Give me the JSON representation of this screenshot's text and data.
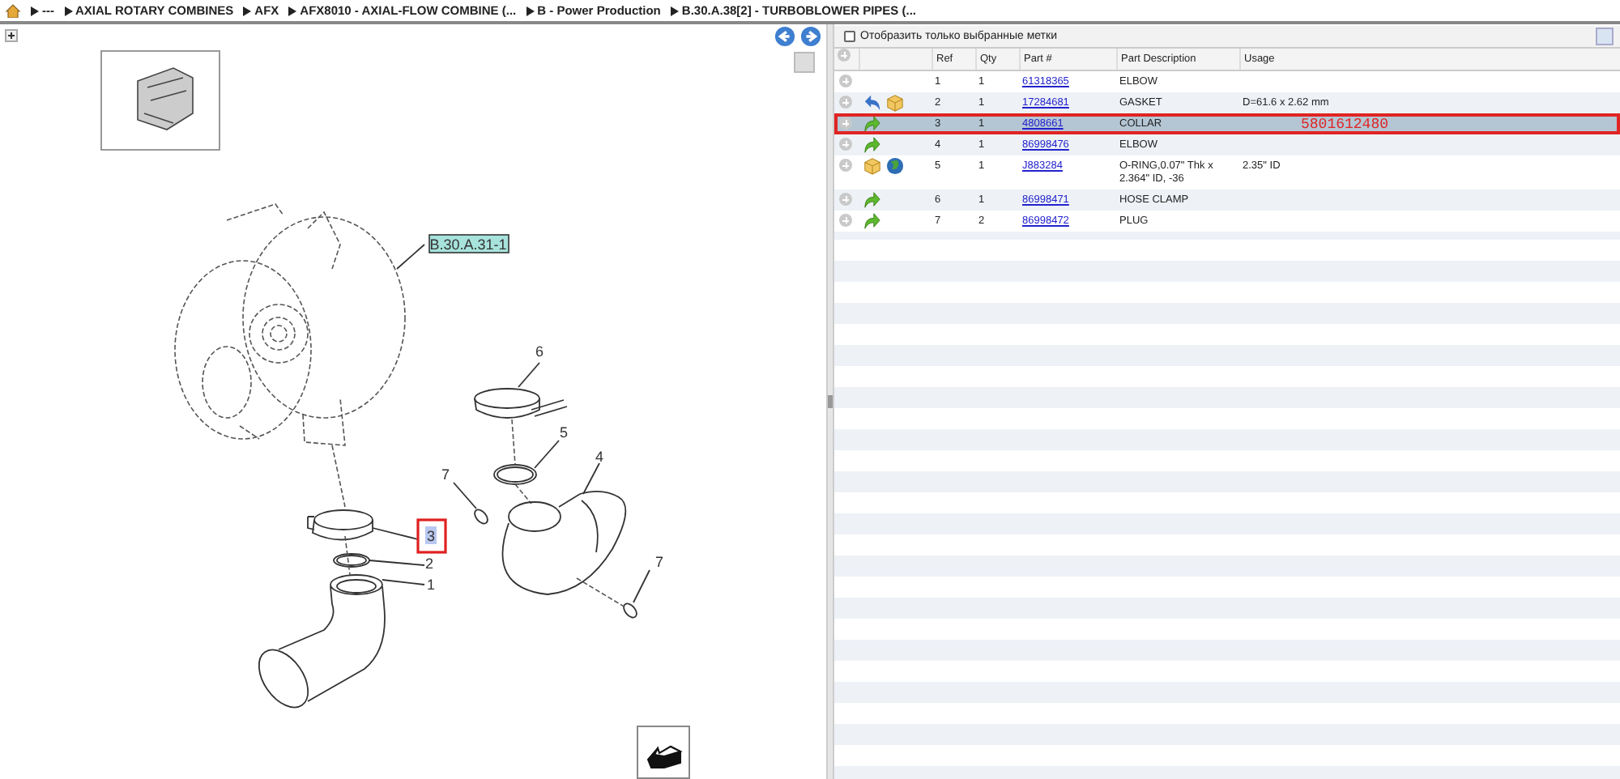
{
  "breadcrumb": {
    "items": [
      "---",
      "AXIAL ROTARY COMBINES",
      "AFX",
      "AFX8010 - AXIAL-FLOW COMBINE (...",
      "B - Power Production",
      "B.30.A.38[2] - TURBOBLOWER PIPES (..."
    ]
  },
  "diagram": {
    "callouts": [
      {
        "label": "B.30.A.31-1",
        "kind": "reference"
      },
      {
        "label": "6",
        "kind": "item",
        "selected": false
      },
      {
        "label": "5",
        "kind": "item",
        "selected": false
      },
      {
        "label": "4",
        "kind": "item",
        "selected": false
      },
      {
        "label": "7",
        "kind": "item",
        "selected": false
      },
      {
        "label": "3",
        "kind": "item",
        "selected": true
      },
      {
        "label": "2",
        "kind": "item",
        "selected": false
      },
      {
        "label": "1",
        "kind": "item",
        "selected": false
      },
      {
        "label": "7",
        "kind": "item",
        "selected": false
      }
    ]
  },
  "filter": {
    "label": "Отобразить только выбранные метки",
    "checked": false
  },
  "table": {
    "columns": [
      "Ref",
      "Qty",
      "Part #",
      "Part Description",
      "Usage"
    ],
    "rows": [
      {
        "icons": [],
        "ref": "1",
        "qty": "1",
        "part": "61318365",
        "description": "ELBOW",
        "selected": false
      },
      {
        "icons": [
          {
            "kind": "blue-arrow"
          },
          {
            "kind": "box"
          }
        ],
        "ref": "2",
        "qty": "1",
        "part": "17284681",
        "description": "GASKET",
        "usage": "D=61.6 x 2.62 mm",
        "selected": false
      },
      {
        "icons": [
          {
            "kind": "green-arrow"
          }
        ],
        "ref": "3",
        "qty": "1",
        "part": "4808661",
        "description": "COLLAR",
        "note": "5801612480",
        "selected": true
      },
      {
        "icons": [
          {
            "kind": "green-arrow"
          }
        ],
        "ref": "4",
        "qty": "1",
        "part": "86998476",
        "description": "ELBOW",
        "selected": false
      },
      {
        "icons": [
          {
            "kind": "box"
          },
          {
            "kind": "globe"
          }
        ],
        "ref": "5",
        "qty": "1",
        "part": "J883284",
        "description": "O-RING,0.07\" Thk x 2.364\" ID, -36",
        "usage": "2.35\"  ID",
        "selected": false
      },
      {
        "icons": [
          {
            "kind": "green-arrow"
          }
        ],
        "ref": "6",
        "qty": "1",
        "part": "86998471",
        "description": "HOSE CLAMP",
        "selected": false
      },
      {
        "icons": [
          {
            "kind": "green-arrow"
          }
        ],
        "ref": "7",
        "qty": "2",
        "part": "86998472",
        "description": "PLUG",
        "selected": false
      }
    ]
  }
}
